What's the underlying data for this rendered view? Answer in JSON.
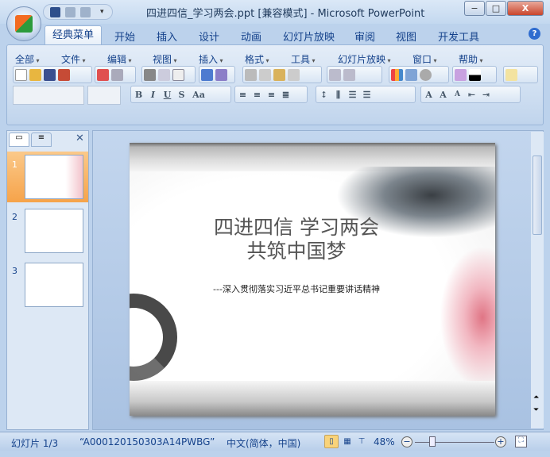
{
  "window": {
    "title": "四进四信_学习两会.ppt [兼容模式] - Microsoft PowerPoint",
    "minimize": "−",
    "maximize": "□",
    "close": "X"
  },
  "tabs": [
    "经典菜单",
    "开始",
    "插入",
    "设计",
    "动画",
    "幻灯片放映",
    "审阅",
    "视图",
    "开发工具"
  ],
  "help_icon": "?",
  "menus": [
    "全部",
    "文件",
    "编辑",
    "视图",
    "插入",
    "格式",
    "工具",
    "幻灯片放映",
    "窗口",
    "帮助"
  ],
  "format_buttons": {
    "bold": "B",
    "italic": "I",
    "underline": "U",
    "shadow": "S",
    "case": "Aa",
    "font_grow": "A",
    "font_shrink": "A"
  },
  "slides_panel": {
    "close": "✕",
    "slides": [
      {
        "num": "1"
      },
      {
        "num": "2"
      },
      {
        "num": "3"
      }
    ]
  },
  "slide": {
    "title_line1": "四进四信 学习两会",
    "title_line2": "共筑中国梦",
    "subtitle": "---深入贯彻落实习近平总书记重要讲话精神"
  },
  "status": {
    "slide": "幻灯片 1/3",
    "theme": "“A000120150303A14PWBG”",
    "language": "中文(简体，中国)",
    "zoom": "48%",
    "zoom_fraction": 0.48
  },
  "colors": {
    "accent": "#15428b",
    "selected": "#f8a94c"
  }
}
